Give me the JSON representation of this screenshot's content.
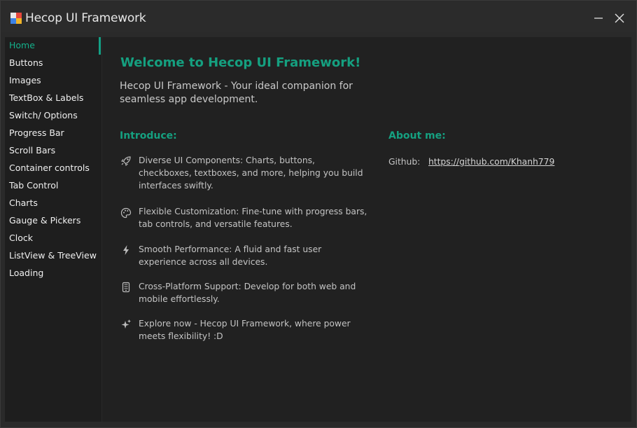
{
  "window": {
    "title": "Hecop UI Framework"
  },
  "sidebar": {
    "items": [
      {
        "label": "Home",
        "active": true
      },
      {
        "label": "Buttons"
      },
      {
        "label": "Images"
      },
      {
        "label": "TextBox & Labels"
      },
      {
        "label": "Switch/ Options"
      },
      {
        "label": "Progress Bar"
      },
      {
        "label": "Scroll Bars"
      },
      {
        "label": "Container controls"
      },
      {
        "label": "Tab Control"
      },
      {
        "label": "Charts"
      },
      {
        "label": "Gauge & Pickers"
      },
      {
        "label": "Clock"
      },
      {
        "label": "ListView & TreeView"
      },
      {
        "label": "Loading"
      }
    ]
  },
  "main": {
    "welcome_title": "Welcome to Hecop UI Framework!",
    "subtitle": "Hecop UI Framework - Your ideal companion for seamless app development.",
    "introduce_heading": "Introduce:",
    "features": [
      {
        "icon": "rocket-icon",
        "text": "Diverse UI Components: Charts, buttons, checkboxes, textboxes, and more, helping you build interfaces swiftly."
      },
      {
        "icon": "palette-icon",
        "text": "Flexible Customization: Fine-tune with progress bars, tab controls, and versatile features."
      },
      {
        "icon": "lightning-icon",
        "text": "Smooth Performance: A fluid and fast user experience across all devices."
      },
      {
        "icon": "mobile-icon",
        "text": "Cross-Platform Support: Develop for both web and mobile effortlessly."
      },
      {
        "icon": "sparkle-icon",
        "text": "Explore now - Hecop UI Framework, where power meets flexibility! :D"
      }
    ],
    "about_heading": "About me:",
    "github_label": "Github:",
    "github_link": "https://github.com/Khanh779"
  },
  "colors": {
    "accent": "#15a080",
    "background": "#212121",
    "sidebar": "#1e1e1e"
  }
}
